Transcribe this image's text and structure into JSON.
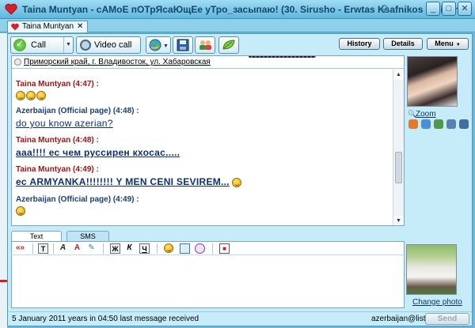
{
  "window": {
    "title": "Taina Muntyan - сАМоЕ пОТрЯсаЮщЕе уТро_засыпаю! (30. Sirusho - Erwtas Ksafnikos - Winamp)",
    "pin_icon": "pin-icon",
    "buttons": [
      "_",
      "□",
      "✕"
    ]
  },
  "tab": {
    "label": "Taina Muntyan",
    "close": "✕"
  },
  "toolbar": {
    "call_label": "Call",
    "video_label": "Video call",
    "history_label": "History",
    "details_label": "Details",
    "menu_label": "Menu",
    "dropdown_glyph": "▼"
  },
  "location": "Приморский край, г. Владивосток, ул. Хабаровская",
  "messages": [
    {
      "sender": "Taina Muntyan (4:47) :",
      "text": ""
    },
    {
      "sender": "Azerbaijan (Official page) (4:48) :",
      "text": "do you know azerian?"
    },
    {
      "sender": "Taina Muntyan (4:48) :",
      "text": "ааа!!!! ес чем руссирен кхосас....."
    },
    {
      "sender": "Taina Muntyan (4:49) :",
      "text": "ес ARMYANKA!!!!!!!! Y   MEN CENI SEVIREM..."
    },
    {
      "sender": "Azerbaijan (Official page) (4:49) :",
      "text": ""
    }
  ],
  "profile": {
    "zoom_label": "Zoom"
  },
  "input": {
    "tab_text": "Text",
    "tab_sms": "SMS",
    "fmt_bold": "Ж",
    "fmt_italic": "К",
    "fmt_underline": "Ч",
    "fmt_translit": "«»",
    "fmt_size": "Т"
  },
  "change_photo_label": "Change photo",
  "status": {
    "left": "5 January 2011 years in 04:50 last message received",
    "right": "azerbaijan@list.ru",
    "send_label": "Send"
  },
  "colors": {
    "title_bg": "#5fb6de",
    "sender_taina": "#a01616",
    "sender_azerbaijan": "#1a3f75",
    "link_text": "#0d2f78"
  }
}
